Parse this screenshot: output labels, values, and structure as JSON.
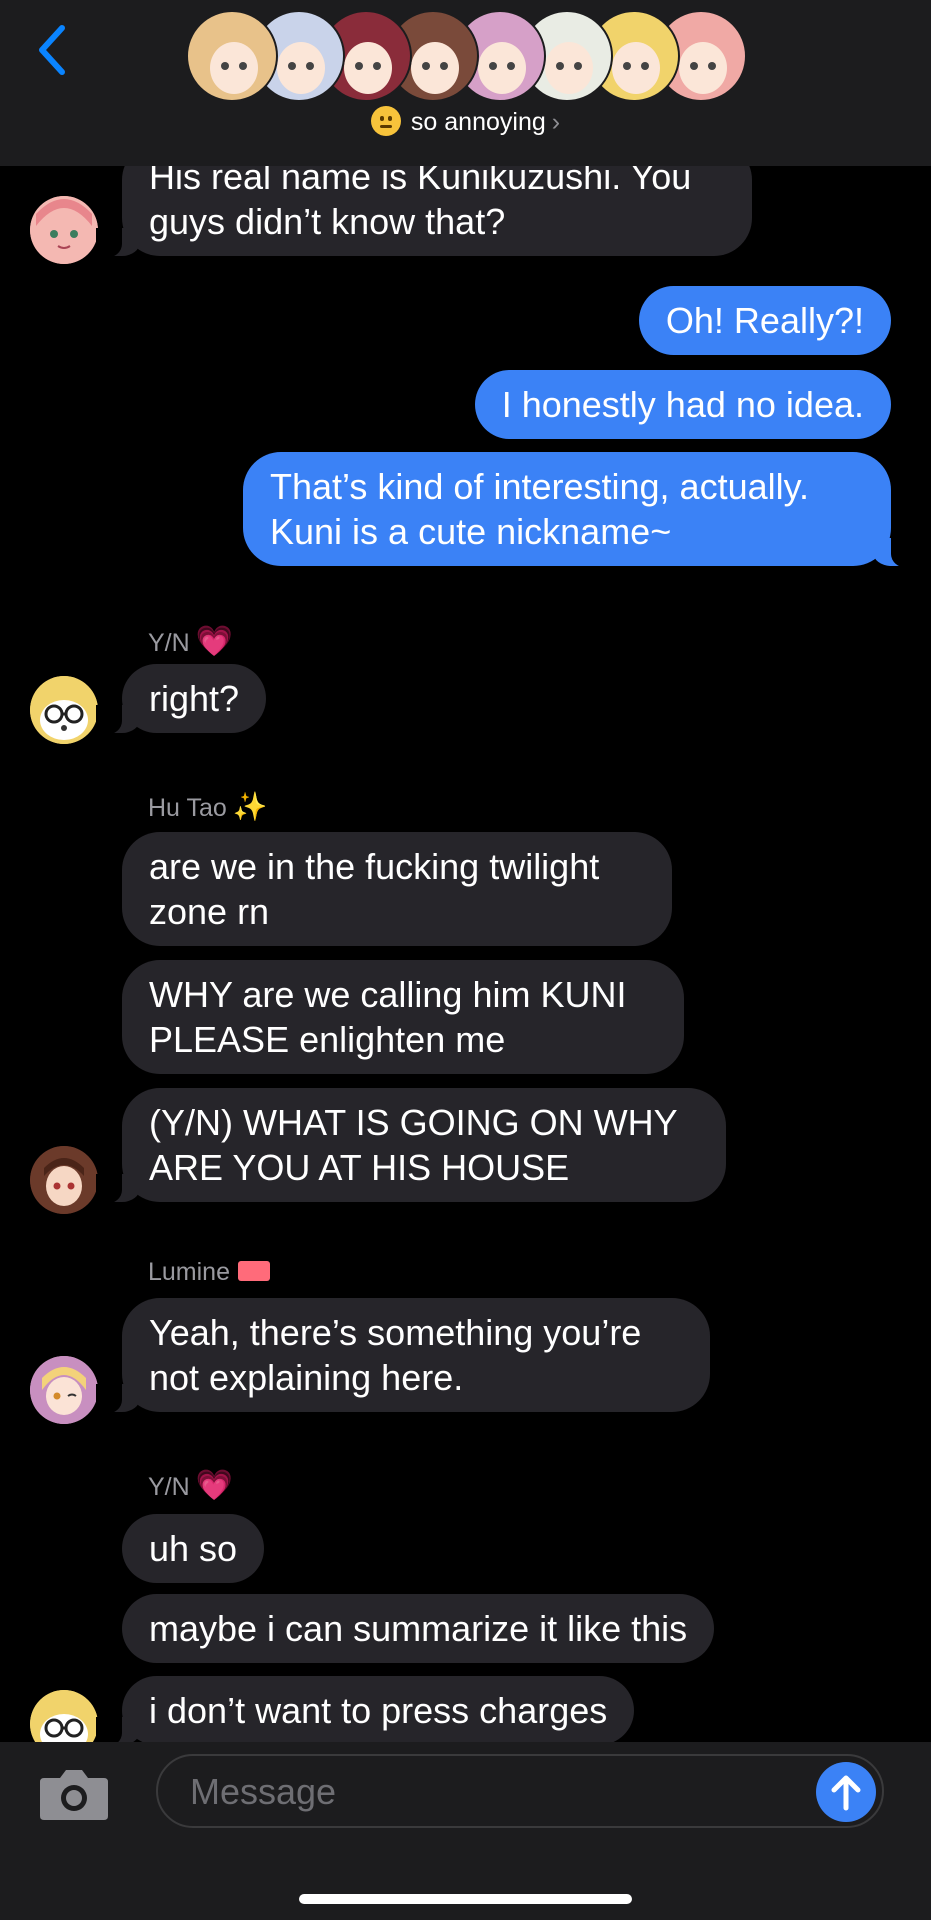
{
  "header": {
    "back_icon": "chevron-left-icon",
    "group_name": "so annoying",
    "group_emoji": "neutral-face-emoji",
    "chevron": "›",
    "participants": [
      {
        "name": "participant-1",
        "color": "#e8c28a"
      },
      {
        "name": "participant-2",
        "color": "#c9d3ea"
      },
      {
        "name": "participant-3",
        "color": "#8a2c3a"
      },
      {
        "name": "participant-4",
        "color": "#7a4a3a"
      },
      {
        "name": "participant-5",
        "color": "#d6a0c8"
      },
      {
        "name": "participant-6",
        "color": "#e9ece4"
      },
      {
        "name": "participant-7",
        "color": "#f1d36b"
      },
      {
        "name": "participant-8",
        "color": "#f0a9a5"
      }
    ]
  },
  "messages": {
    "m1": "His real name is Kunikuzushi. You\nguys didn’t know that?",
    "m2": "Oh! Really?!",
    "m3": "I honestly had no idea.",
    "m4": "That’s kind of interesting, actually.\nKuni is a cute nickname~",
    "sender_yn": "Y/N",
    "m5": "right?",
    "sender_hutao": "Hu Tao",
    "m6": "are we in the fucking twilight\nzone rn",
    "m7": "WHY are we calling him KUNI\nPLEASE enlighten me",
    "m8": "(Y/N) WHAT IS GOING ON WHY\nARE YOU AT HIS HOUSE",
    "sender_lumine": "Lumine",
    "m9": "Yeah, there’s something you’re\nnot explaining here.",
    "sender_yn2": "Y/N",
    "m10": "uh so",
    "m11": "maybe i can summarize it like this",
    "m12": "i don’t want to press charges"
  },
  "sender_badges": {
    "yn": "💗",
    "hutao": "✨"
  },
  "composer": {
    "placeholder": "Message",
    "camera_icon": "camera-icon",
    "send_icon": "arrow-up-icon"
  },
  "colors": {
    "outgoing": "#3b82f6",
    "incoming": "#26252a",
    "header": "#1c1c1e"
  }
}
